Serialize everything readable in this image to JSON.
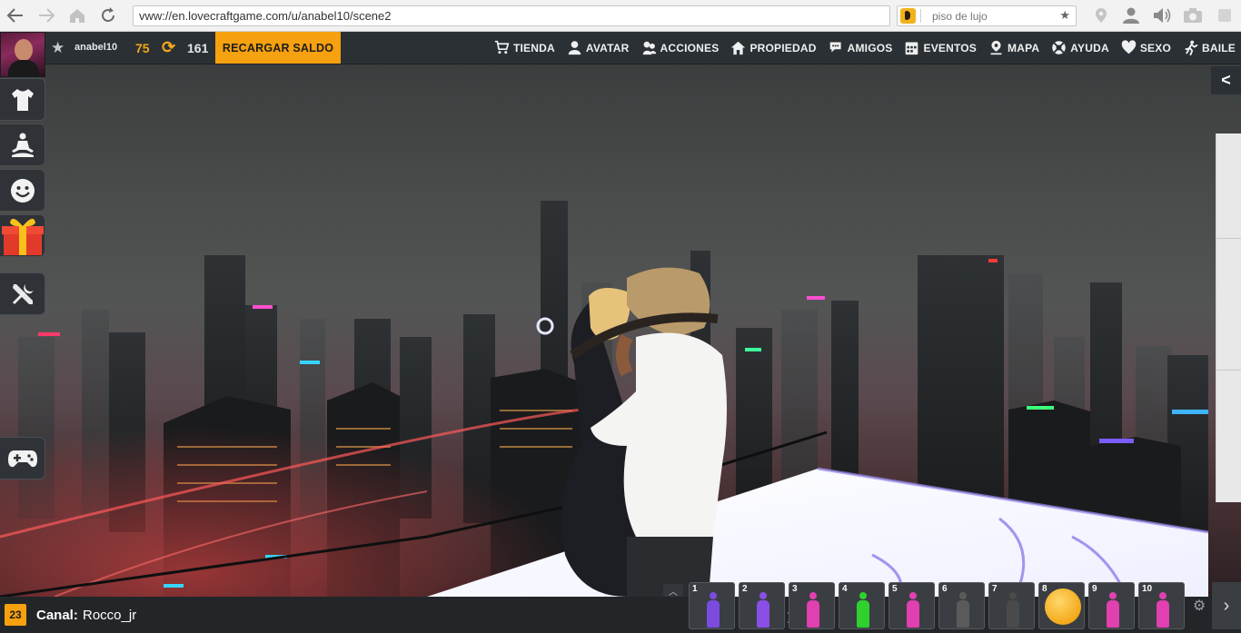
{
  "browser": {
    "url": "vww://en.lovecraftgame.com/u/anabel10/scene2",
    "search_text": "piso de lujo"
  },
  "header": {
    "username": "anabel10",
    "gold": "75",
    "silver": "161",
    "recharge_label": "RECARGAR SALDO",
    "menu": [
      {
        "label": "TIENDA",
        "icon": "cart-icon"
      },
      {
        "label": "AVATAR",
        "icon": "person-icon"
      },
      {
        "label": "ACCIONES",
        "icon": "actions-icon"
      },
      {
        "label": "PROPIEDAD",
        "icon": "house-icon"
      },
      {
        "label": "AMIGOS",
        "icon": "friends-icon"
      },
      {
        "label": "EVENTOS",
        "icon": "calendar-icon"
      },
      {
        "label": "MAPA",
        "icon": "map-pin-icon"
      },
      {
        "label": "AYUDA",
        "icon": "lifebuoy-icon"
      },
      {
        "label": "SEXO",
        "icon": "heart-icon"
      },
      {
        "label": "BAILE",
        "icon": "dance-icon"
      }
    ]
  },
  "tools": [
    {
      "name": "shirt-icon"
    },
    {
      "name": "meditate-icon"
    },
    {
      "name": "smiley-icon"
    },
    {
      "name": "gift-icon"
    },
    {
      "name": "tools-icon"
    },
    {
      "name": "gamepad-icon"
    }
  ],
  "side": {
    "collapse_label": "<"
  },
  "bottom": {
    "channel_count": "23",
    "channel_label": "Canal:",
    "channel_value": "Rocco_jr"
  },
  "animations": [
    {
      "num": "1",
      "color": "#7b4be0"
    },
    {
      "num": "2",
      "color": "#8a4fe6"
    },
    {
      "num": "3",
      "color": "#e040b0"
    },
    {
      "num": "4",
      "color": "#2fd12f"
    },
    {
      "num": "5",
      "color": "#e040b0"
    },
    {
      "num": "6",
      "color": "#5a5a5a"
    },
    {
      "num": "7",
      "color": "#4a4a4a"
    },
    {
      "num": "8",
      "color": "#f3a91a"
    },
    {
      "num": "9",
      "color": "#e040b0"
    },
    {
      "num": "10",
      "color": "#e040b0"
    }
  ],
  "colors": {
    "accent": "#f6a10f",
    "header_bg": "#2b3034"
  }
}
